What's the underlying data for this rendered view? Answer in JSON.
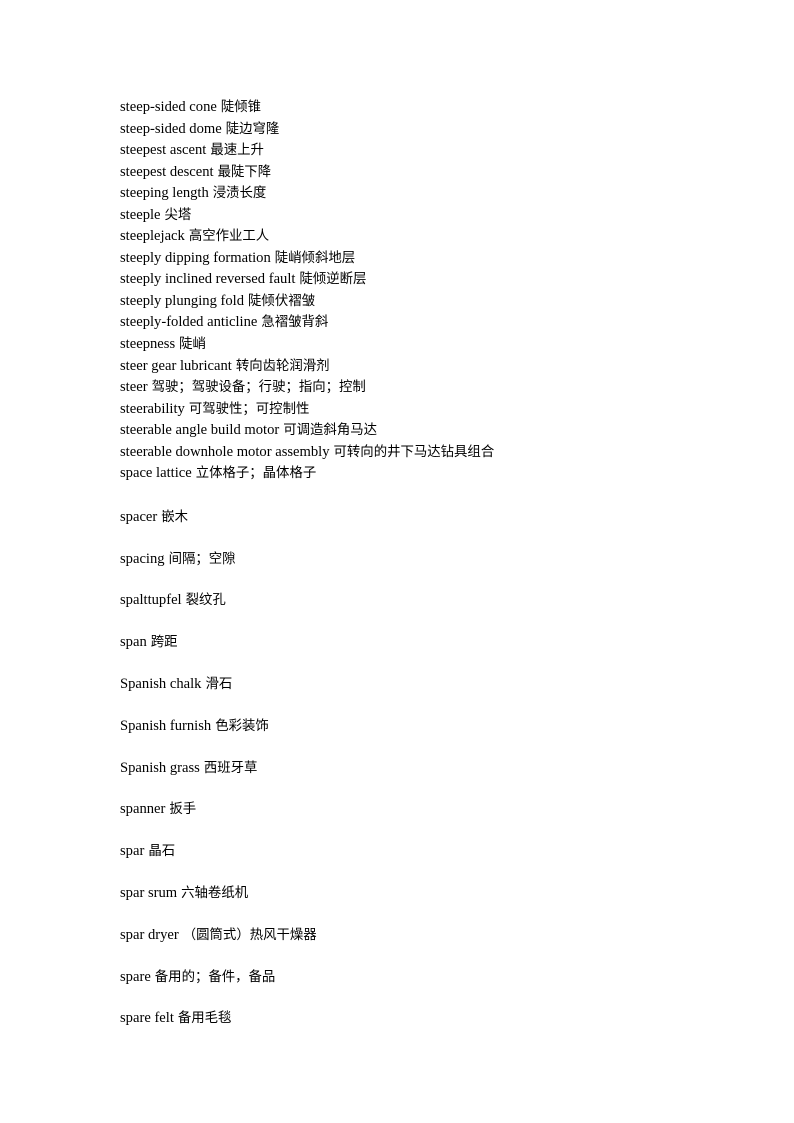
{
  "document": {
    "type": "glossary-page",
    "background_color": "#ffffff",
    "text_color": "#000000",
    "sections": [
      {
        "name": "dense-block",
        "spacing": "single",
        "entries": [
          {
            "term": "steep-sided cone",
            "gloss": "陡倾锥"
          },
          {
            "term": "steep-sided dome",
            "gloss": "陡边穹隆"
          },
          {
            "term": "steepest ascent",
            "gloss": "最速上升"
          },
          {
            "term": "steepest descent",
            "gloss": "最陡下降"
          },
          {
            "term": "steeping length",
            "gloss": "浸渍长度"
          },
          {
            "term": "steeple",
            "gloss": "尖塔"
          },
          {
            "term": "steeplejack",
            "gloss": "高空作业工人"
          },
          {
            "term": "steeply dipping formation",
            "gloss": "陡峭倾斜地层"
          },
          {
            "term": "steeply inclined reversed fault",
            "gloss": "陡倾逆断层"
          },
          {
            "term": "steeply plunging fold",
            "gloss": "陡倾伏褶皱"
          },
          {
            "term": "steeply-folded anticline",
            "gloss": "急褶皱背斜"
          },
          {
            "term": "steepness",
            "gloss": "陡峭"
          },
          {
            "term": "steer gear lubricant",
            "gloss": "转向齿轮润滑剂"
          },
          {
            "term": "steer",
            "gloss": "驾驶；驾驶设备；行驶；指向；控制"
          },
          {
            "term": "steerability",
            "gloss": "可驾驶性；可控制性"
          },
          {
            "term": "steerable angle build motor",
            "gloss": "可调造斜角马达"
          },
          {
            "term": "steerable downhole motor assembly",
            "gloss": "可转向的井下马达钻具组合"
          },
          {
            "term": "space lattice",
            "gloss": "立体格子；晶体格子"
          }
        ]
      },
      {
        "name": "spaced-block",
        "spacing": "double",
        "entries": [
          {
            "term": "spacer",
            "gloss": "嵌木"
          },
          {
            "term": "spacing",
            "gloss": "间隔；空隙"
          },
          {
            "term": "spalttupfel",
            "gloss": "裂纹孔"
          },
          {
            "term": "span",
            "gloss": "跨距"
          },
          {
            "term": "Spanish chalk",
            "gloss": "滑石"
          },
          {
            "term": "Spanish furnish",
            "gloss": "色彩装饰"
          },
          {
            "term": "Spanish grass",
            "gloss": "西班牙草"
          },
          {
            "term": "spanner",
            "gloss": "扳手"
          },
          {
            "term": "spar",
            "gloss": "晶石"
          },
          {
            "term": "spar srum",
            "gloss": "六轴卷纸机"
          },
          {
            "term": "spar dryer",
            "gloss": "（圆筒式）热风干燥器"
          },
          {
            "term": "spare",
            "gloss": "备用的；备件，备品"
          },
          {
            "term": "spare felt",
            "gloss": "备用毛毯"
          }
        ]
      }
    ]
  }
}
